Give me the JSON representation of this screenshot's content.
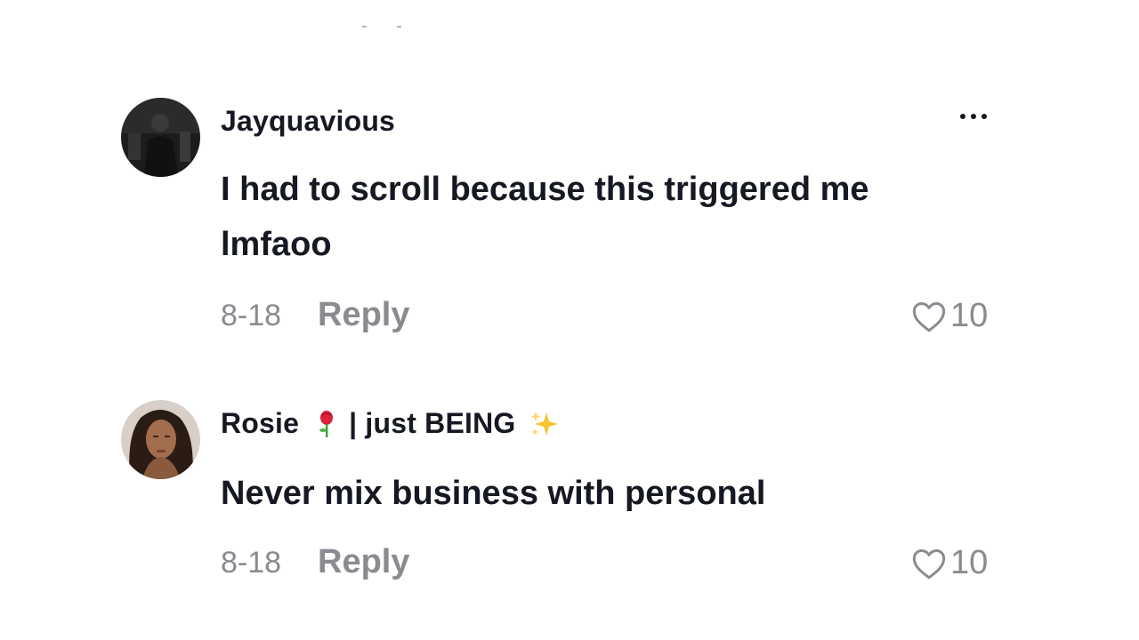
{
  "comments": [
    {
      "username": "Jayquavious",
      "text_line1": "I had to scroll because this triggered me",
      "text_line2": "lmfaoo",
      "date": "8-18",
      "reply_label": "Reply",
      "likes": "10",
      "avatar_icon": "user-photo-dark",
      "more_icon": "ellipsis-icon"
    },
    {
      "username_part1": "Rosie",
      "username_part2": "| just BEING",
      "username_emoji1": "rose-emoji",
      "username_emoji2": "sparkles-emoji",
      "text": "Never mix business with personal",
      "date": "8-18",
      "reply_label": "Reply",
      "likes": "10",
      "avatar_icon": "user-photo-woman"
    }
  ],
  "colors": {
    "primary_text": "#161823",
    "secondary_text": "#8a8b91",
    "background": "#ffffff"
  }
}
